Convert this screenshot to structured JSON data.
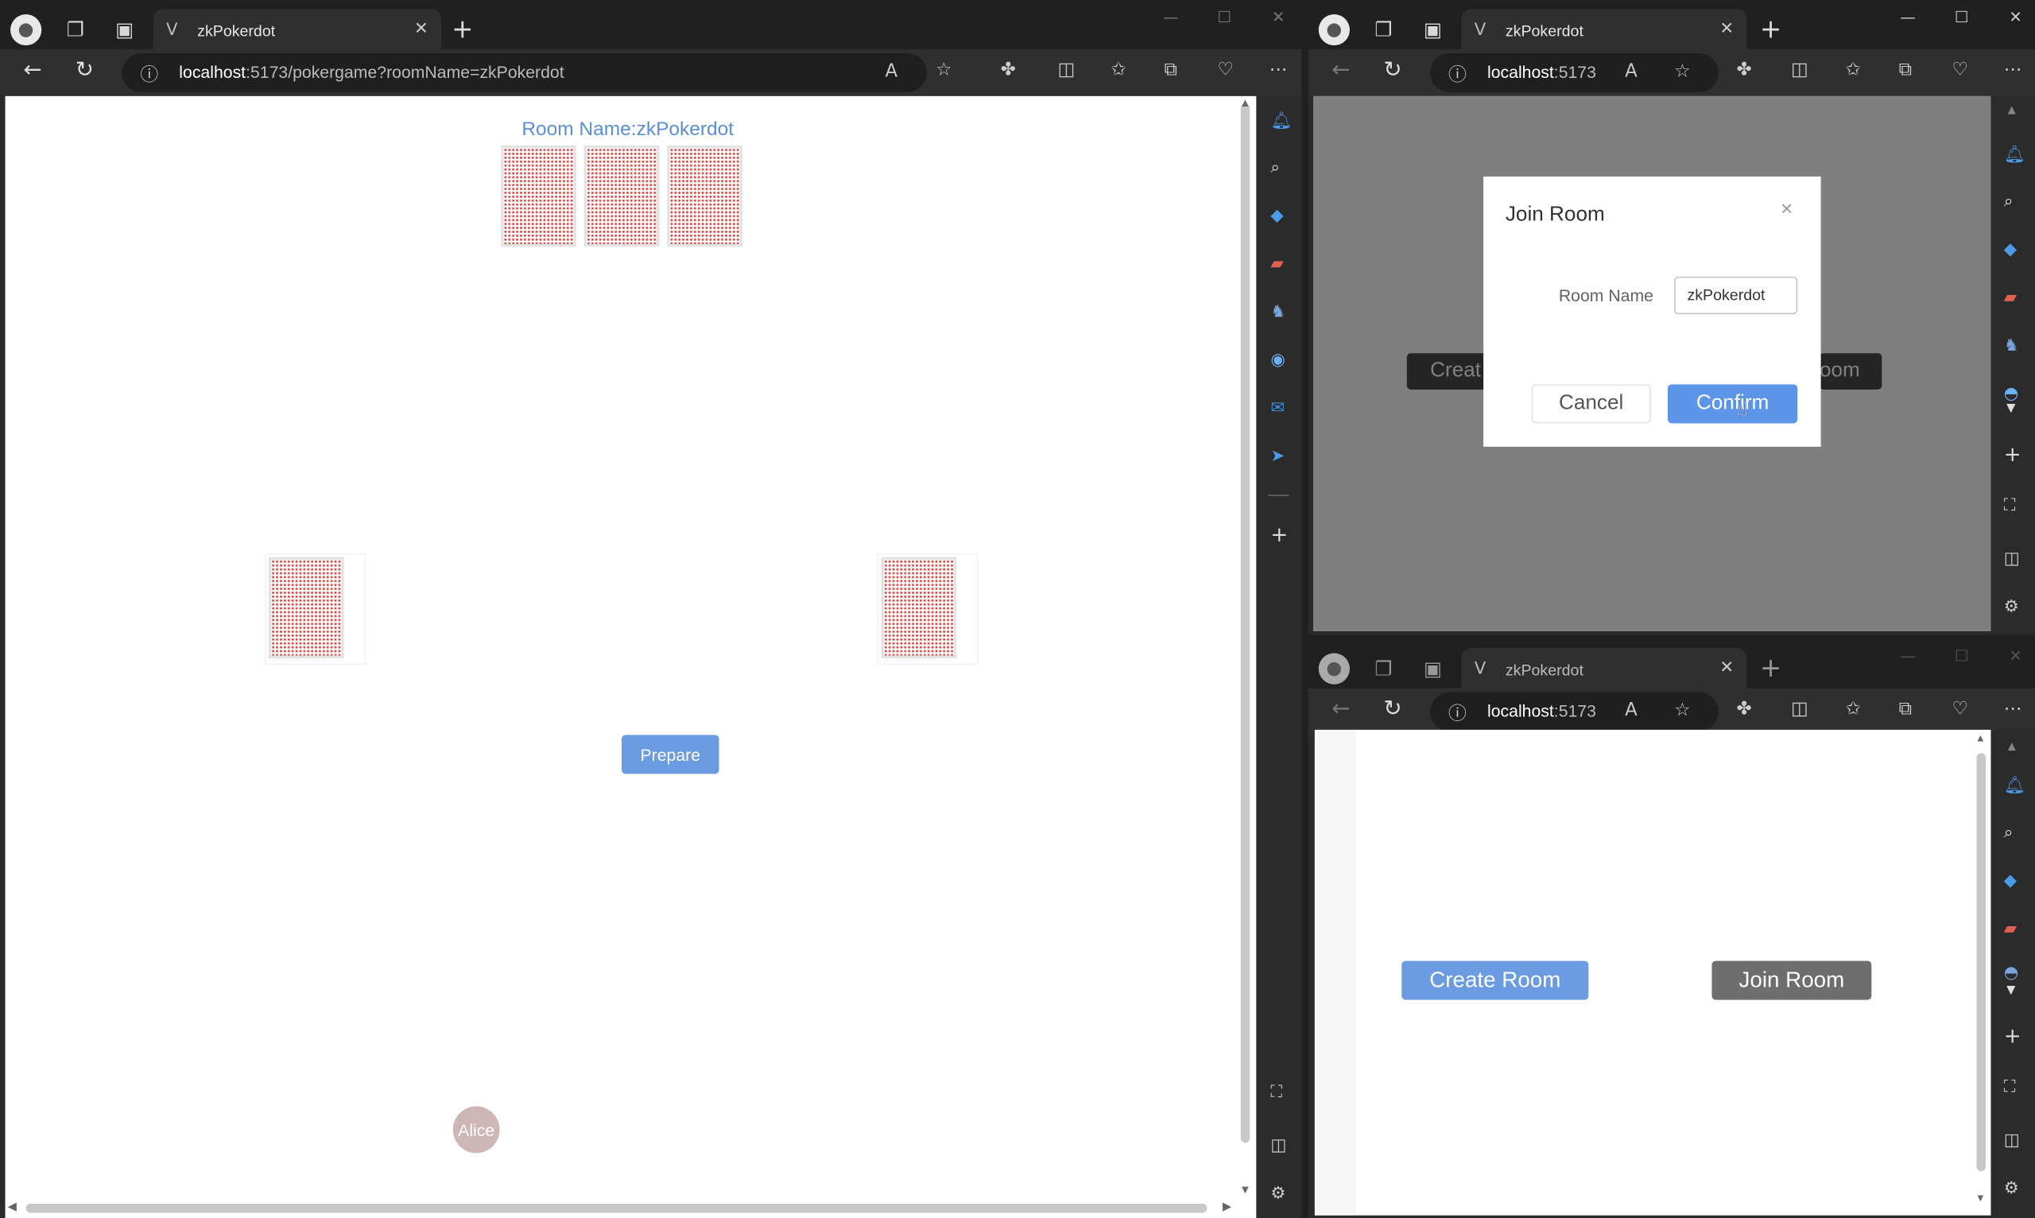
{
  "left_window": {
    "tab_title": "zkPokerdot",
    "url_host": "localhost",
    "url_rest": ":5173/pokergame?roomName=zkPokerdot",
    "page": {
      "room_label": "Room Name:zkPokerdot",
      "prepare_button": "Prepare",
      "player_name": "Alice"
    }
  },
  "top_right_window": {
    "tab_title": "zkPokerdot",
    "url_host": "localhost",
    "url_rest": ":5173",
    "background_buttons": {
      "create_partial": "Creat",
      "join_partial": "oom"
    },
    "dialog": {
      "title": "Join Room",
      "close_symbol": "×",
      "field_label": "Room Name",
      "field_value": "zkPokerdot",
      "cancel": "Cancel",
      "confirm": "Confirm"
    }
  },
  "bottom_right_window": {
    "tab_title": "zkPokerdot",
    "url_host": "localhost",
    "url_rest": ":5173",
    "create_room": "Create Room",
    "join_room": "Join Room"
  },
  "colors": {
    "accent": "#6b9be0",
    "card_pattern": "#d9534f",
    "avatar": "#cfb6b6",
    "room_label": "#5b8ed6"
  },
  "icons": [
    "profile-icon",
    "workspaces-icon",
    "tab-actions-icon",
    "back-icon",
    "refresh-icon",
    "info-icon",
    "read-aloud-icon",
    "favorite-icon",
    "extensions-icon",
    "split-screen-icon",
    "favorites-icon",
    "collections-icon",
    "browser-essentials-icon",
    "more-icon",
    "bell-icon",
    "search-icon",
    "tag-icon",
    "toolbox-icon",
    "games-icon",
    "copilot-icon",
    "outlook-icon",
    "send-icon",
    "add-icon",
    "screenshot-icon",
    "sidebar-toggle-icon",
    "settings-icon"
  ]
}
